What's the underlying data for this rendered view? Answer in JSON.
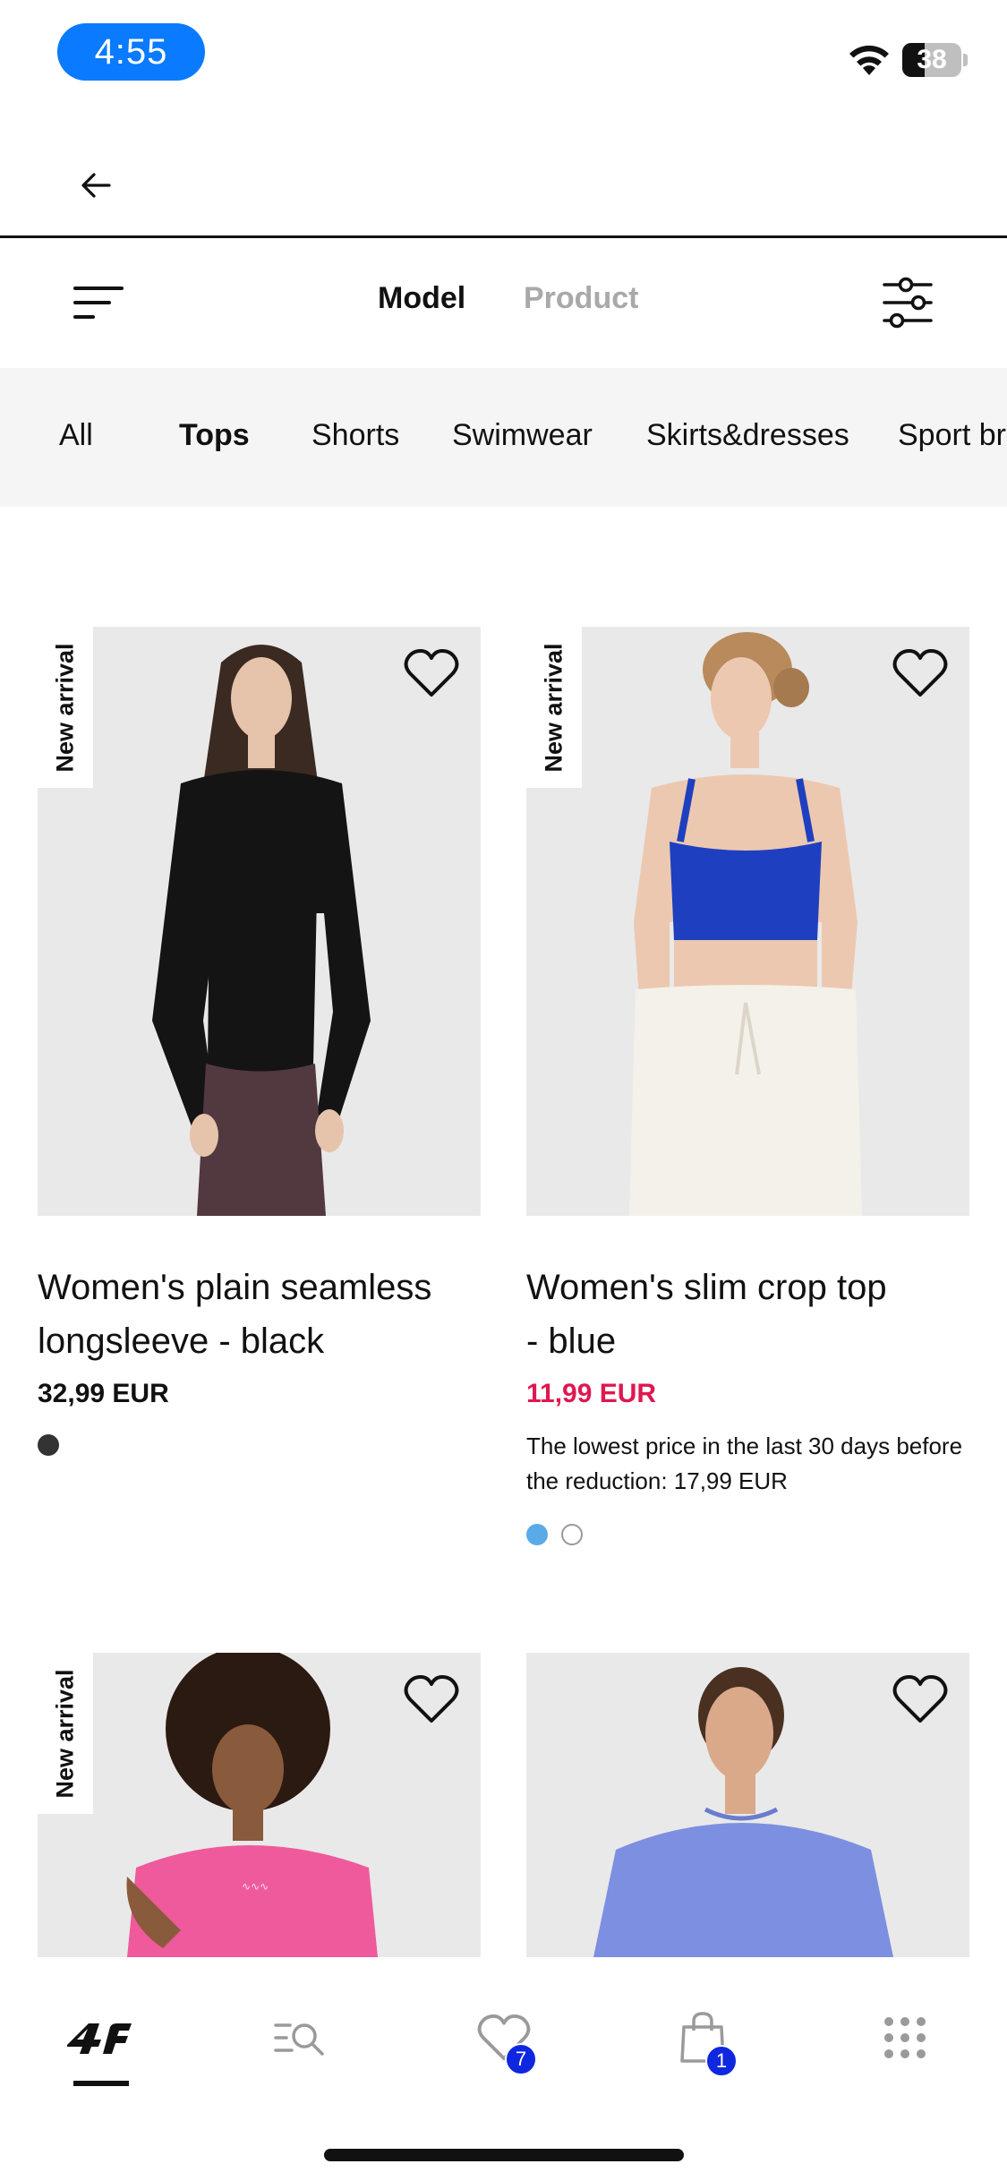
{
  "status_bar": {
    "time": "4:55",
    "battery": "38",
    "battery_level": 0.38
  },
  "toolbar": {
    "tab_model": "Model",
    "tab_product": "Product"
  },
  "categories": [
    {
      "label": "All",
      "active": false
    },
    {
      "label": "Tops",
      "active": true
    },
    {
      "label": "Shorts",
      "active": false
    },
    {
      "label": "Swimwear",
      "active": false
    },
    {
      "label": "Skirts&dresses",
      "active": false
    },
    {
      "label": "Sport br",
      "active": false
    }
  ],
  "products": [
    {
      "badge": "New arrival",
      "title_line1": "Women's plain seamless",
      "title_line2": "longsleeve - black",
      "price": "32,99 EUR",
      "swatches": [
        "#333333"
      ]
    },
    {
      "badge": "New arrival",
      "title_line1": "Women's slim crop top",
      "title_line2": "- blue",
      "price": "11,99 EUR",
      "lowest_price_note": "The lowest price in the last 30 days before the reduction: 17,99 EUR",
      "swatches": [
        "#5aaae8",
        "#ffffff"
      ]
    },
    {
      "badge": "New arrival"
    },
    {}
  ],
  "bottom_nav": {
    "wishlist_count": "7",
    "cart_count": "1"
  },
  "colors": {
    "sale": "#e0174f",
    "badge": "#1027e0",
    "time_pill": "#0a7aff"
  }
}
